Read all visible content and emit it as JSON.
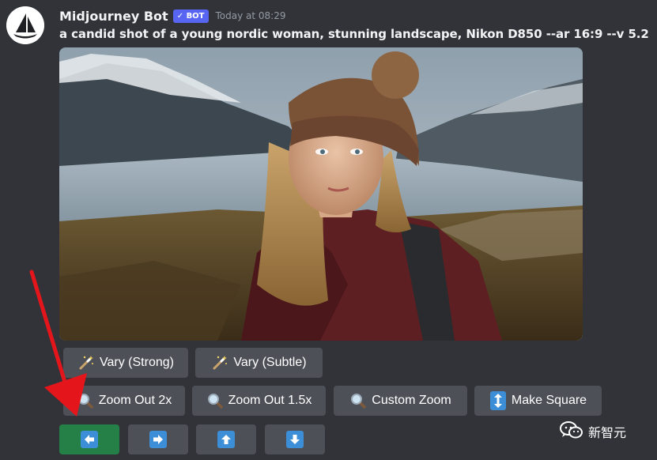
{
  "message": {
    "username": "Midjourney Bot",
    "bot_tag": "✓ BOT",
    "timestamp": "Today at 08:29",
    "prompt": "a candid shot of a young nordic woman, stunning landscape, Nikon D850 --ar 16:9 --v 5.2"
  },
  "buttons": {
    "vary_strong": "Vary (Strong)",
    "vary_subtle": "Vary (Subtle)",
    "zoom_out_2x": "Zoom Out 2x",
    "zoom_out_15x": "Zoom Out 1.5x",
    "custom_zoom": "Custom Zoom",
    "make_square": "Make Square",
    "pan_left": "⬅",
    "pan_right": "➡",
    "pan_up": "⬆",
    "pan_down": "⬇"
  },
  "icons": {
    "wand": "magic-wand-icon",
    "zoom": "magnifier-icon",
    "square": "up-down-arrow-icon"
  },
  "watermark": {
    "text": "新智元"
  },
  "colors": {
    "background": "#313338",
    "button": "#4e5058",
    "primary_button": "#248046",
    "bot_tag": "#5865f2",
    "annotation_arrow": "#e4161b"
  }
}
